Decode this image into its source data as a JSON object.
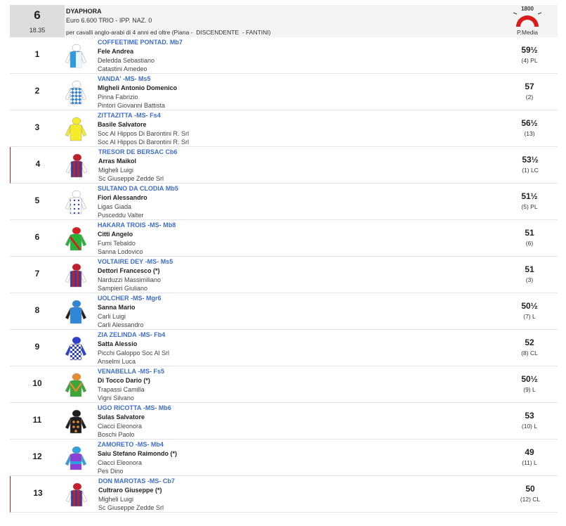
{
  "race": {
    "number": "6",
    "time": "18.35",
    "name": "DYAPHORA",
    "prize": "Euro 6.600 TRIO - IPP. NAZ. 0",
    "conditions": "per cavalli anglo-arabi di 4 anni ed oltre (Piana -  DISCENDENTE  - FANTINI)",
    "logo_number": "1800",
    "logo_label": "P.Media"
  },
  "runners": [
    {
      "num": "1",
      "horse": "COFFEETIME PONTAD.",
      "ms": "",
      "code": "Mb7",
      "jockey": "Fele Andrea",
      "trainer": "Deledda Sebastiano",
      "owner": "Catastini Amedeo",
      "weight": "59½",
      "note": "(4) PL",
      "marked": false,
      "silk": {
        "body": "#2e9be0",
        "sleeve": "#ffffff",
        "pattern": "split",
        "cap": "#ffffff"
      }
    },
    {
      "num": "2",
      "horse": "VANDA'",
      "ms": "-MS-",
      "code": "Ms5",
      "jockey": "Migheli Antonio Domenico",
      "trainer": "Pinna Fabrizio",
      "owner": "Pintori Giovanni Battista",
      "weight": "57",
      "note": "(2)",
      "marked": false,
      "silk": {
        "body": "#ffffff",
        "sleeve": "#ffffff",
        "pattern": "diamonds-blue",
        "cap": "#ffffff"
      }
    },
    {
      "num": "3",
      "horse": "ZITTAZITTA",
      "ms": "-MS-",
      "code": "Fs4",
      "jockey": "Basile Salvatore",
      "trainer": "Soc Al Hippos Di Barontini R. Srl",
      "owner": "Soc Al Hippos Di Barontini R. Srl",
      "weight": "56½",
      "note": "(13)",
      "marked": false,
      "silk": {
        "body": "#f4ec2a",
        "sleeve": "#f4ec2a",
        "pattern": "plain",
        "cap": "#f4ec2a"
      }
    },
    {
      "num": "4",
      "horse": "TRESOR DE BERSAC",
      "ms": "",
      "code": "Cb6",
      "jockey": "Arras Maikol",
      "trainer": "Migheli Luigi",
      "owner": "Sc Giuseppe Zedde Srl",
      "weight": "53½",
      "note": "(1) LC",
      "marked": true,
      "silk": {
        "body": "#3a3f9a",
        "sleeve": "#ffffff",
        "pattern": "stripes-red",
        "cap": "#c41e2a"
      }
    },
    {
      "num": "5",
      "horse": "SULTANO DA CLODIA",
      "ms": "",
      "code": "Mb5",
      "jockey": "Fiori Alessandro",
      "trainer": "Ligas Giada",
      "owner": "Pusceddu Valter",
      "weight": "51½",
      "note": "(5) PL",
      "marked": false,
      "silk": {
        "body": "#ffffff",
        "sleeve": "#ffffff",
        "pattern": "dots-blue",
        "cap": "#ffffff"
      }
    },
    {
      "num": "6",
      "horse": "HAKARA TROIS",
      "ms": "-MS-",
      "code": "Mb8",
      "jockey": "Citti Angelo",
      "trainer": "Fumi Tebaldo",
      "owner": "Sanna Lodovico",
      "weight": "51",
      "note": "(6)",
      "marked": false,
      "silk": {
        "body": "#27b33a",
        "sleeve": "#27b33a",
        "pattern": "sash-red",
        "cap": "#d42020"
      }
    },
    {
      "num": "7",
      "horse": "VOLTAIRE DEY",
      "ms": "-MS-",
      "code": "Ms5",
      "jockey": "Dettori Francesco (*)",
      "trainer": "Narduzzi Massimiliano",
      "owner": "Sampieri Giuliano",
      "weight": "51",
      "note": "(3)",
      "marked": false,
      "silk": {
        "body": "#3a3f9a",
        "sleeve": "#ffffff",
        "pattern": "stripes-red",
        "cap": "#c41e2a"
      }
    },
    {
      "num": "8",
      "horse": "UOLCHER",
      "ms": "-MS-",
      "code": "Mgr6",
      "jockey": "Sanna Mario",
      "trainer": "Carli Luigi",
      "owner": "Carli Alessandro",
      "weight": "50½",
      "note": "(7) L",
      "marked": false,
      "silk": {
        "body": "#2e86d6",
        "sleeve": "#1e1e1e",
        "pattern": "plain",
        "cap": "#2e86d6"
      }
    },
    {
      "num": "9",
      "horse": "ZIA ZELINDA",
      "ms": "-MS-",
      "code": "Fb4",
      "jockey": "Satta Alessio",
      "trainer": "Picchi Galoppo Soc Al Srl",
      "owner": "Anselmi Luca",
      "weight": "52",
      "note": "(8) CL",
      "marked": false,
      "silk": {
        "body": "#2b3fd0",
        "sleeve": "#2b3fd0",
        "pattern": "check",
        "cap": "#2b3fd0"
      }
    },
    {
      "num": "10",
      "horse": "VENABELLA",
      "ms": "-MS-",
      "code": "Fs5",
      "jockey": "Di Tocco Dario (*)",
      "trainer": "Trapassi Camilla",
      "owner": "Vigni Silvano",
      "weight": "50½",
      "note": "(9) L",
      "marked": false,
      "silk": {
        "body": "#3aa63a",
        "sleeve": "#3aa63a",
        "pattern": "chevron-orange",
        "cap": "#e88a2e"
      }
    },
    {
      "num": "11",
      "horse": "UGO RICOTTA",
      "ms": "-MS-",
      "code": "Mb6",
      "jockey": "Sulas Salvatore",
      "trainer": "Ciacci Eleonora",
      "owner": "Boschi Paolo",
      "weight": "53",
      "note": "(10) L",
      "marked": false,
      "silk": {
        "body": "#1e1e1e",
        "sleeve": "#1e1e1e",
        "pattern": "dots-orange",
        "cap": "#1e1e1e"
      }
    },
    {
      "num": "12",
      "horse": "ZAMORETO",
      "ms": "-MS-",
      "code": "Mb4",
      "jockey": "Saiu Stefano Raimondo (*)",
      "trainer": "Ciacci Eleonora",
      "owner": "Pes Dino",
      "weight": "49",
      "note": "(11) L",
      "marked": false,
      "silk": {
        "body": "#8a3fd6",
        "sleeve": "#2fa0e0",
        "pattern": "hoop-cyan",
        "cap": "#2fa0e0"
      }
    },
    {
      "num": "13",
      "horse": "DON MAROTAS",
      "ms": "-MS-",
      "code": "Cb7",
      "jockey": "Cultraro Giuseppe (*)",
      "trainer": "Migheli Luigi",
      "owner": "Sc Giuseppe Zedde Srl",
      "weight": "50",
      "note": "(12) CL",
      "marked": true,
      "silk": {
        "body": "#3a3f9a",
        "sleeve": "#ffffff",
        "pattern": "stripes-red",
        "cap": "#c41e2a"
      }
    }
  ]
}
